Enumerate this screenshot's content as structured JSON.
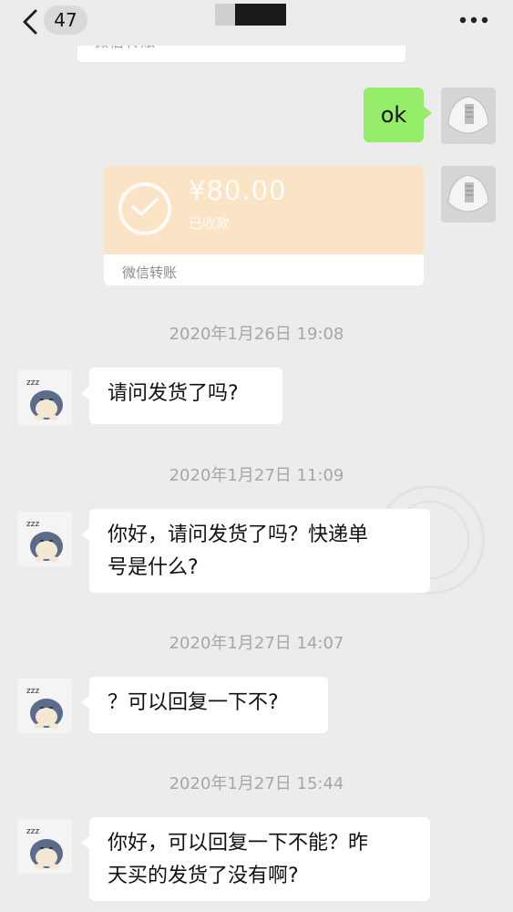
{
  "header": {
    "back_count": "47"
  },
  "transfer_top": {
    "label": "微信转账"
  },
  "messages": {
    "ok_text": "ok",
    "transfer": {
      "amount": "¥80.00",
      "status": "已收款",
      "footer": "微信转账"
    }
  },
  "timestamps": [
    "2020年1月26日 19:08",
    "2020年1月27日 11:09",
    "2020年1月27日 14:07",
    "2020年1月27日 15:44"
  ],
  "incoming": [
    {
      "line1": "请问发货了吗?",
      "line2": ""
    },
    {
      "line1": "你好，请问发货了吗？快递单",
      "line2": "号是什么?"
    },
    {
      "line1": "？可以回复一下不?",
      "line2": ""
    },
    {
      "line1": "你好，可以回复一下不能？昨",
      "line2": "天买的发货了没有啊?"
    }
  ],
  "icons": {
    "back": "chevron-left-icon",
    "more": "more-dots-icon",
    "transfer_check": "check-circle-icon"
  },
  "colors": {
    "background": "#ececec",
    "sent_bubble": "#95ec69",
    "received_bubble": "#ffffff",
    "transfer_card": "#fbe4c5"
  }
}
